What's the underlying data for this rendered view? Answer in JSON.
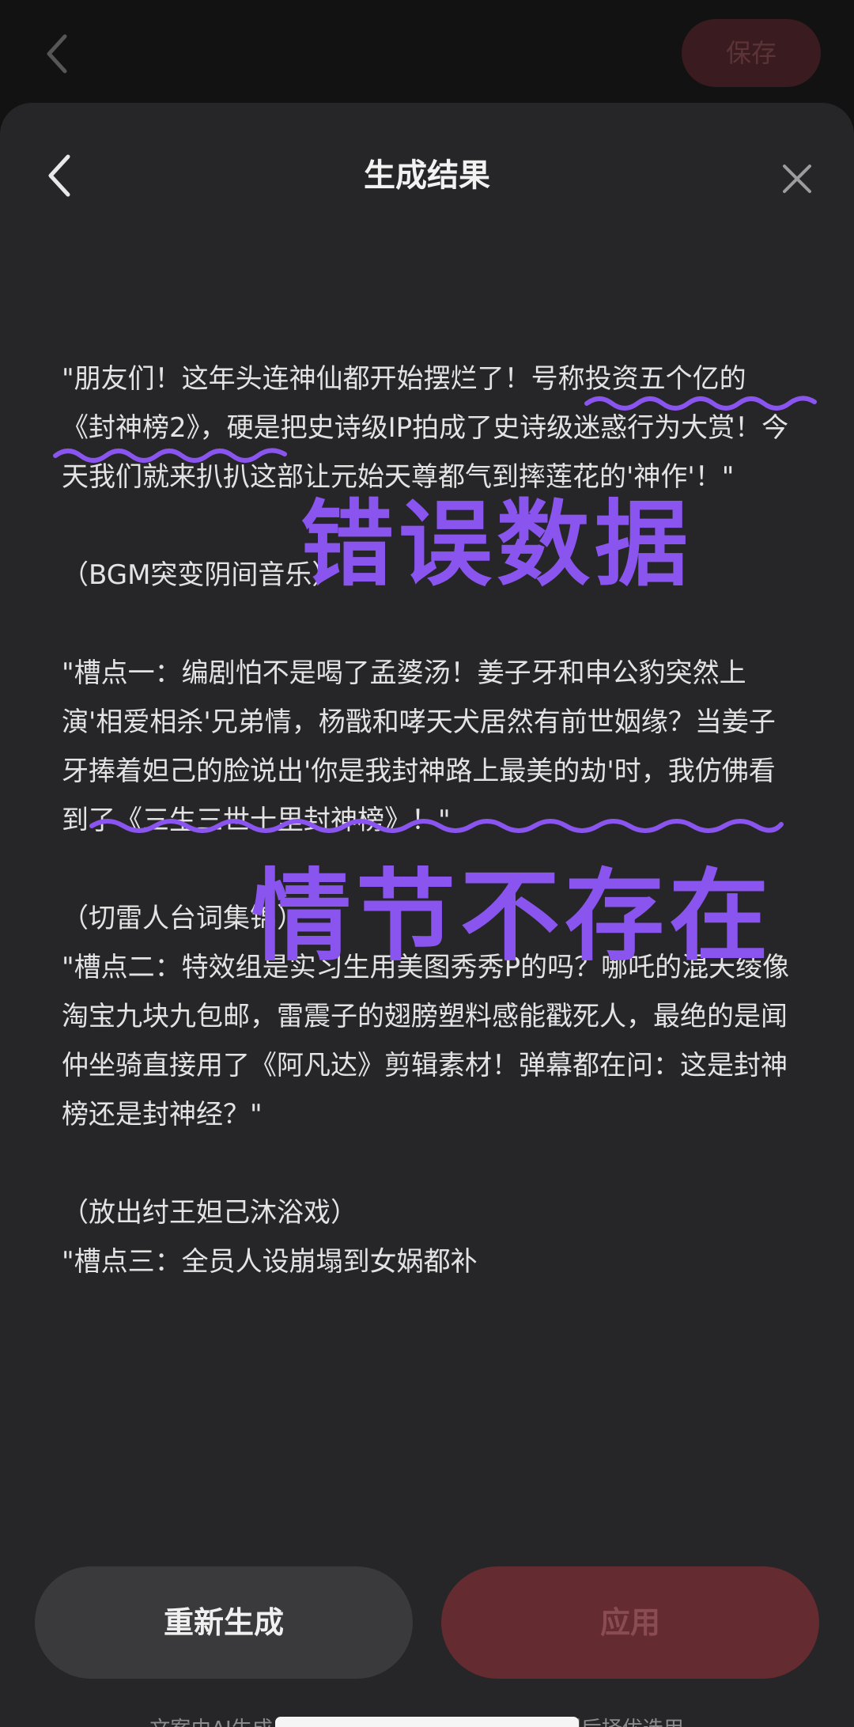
{
  "background_page": {
    "save_label": "保存"
  },
  "sheet": {
    "title": "生成结果",
    "paragraphs": [
      "\"朋友们！这年头连神仙都开始摆烂了！号称投资五个亿的《封神榜2》，硬是把史诗级IP拍成了史诗级迷惑行为大赏！今天我们就来扒扒这部让元始天尊都气到摔莲花的'神作'！\"",
      "（BGM突变阴间音乐）",
      "\"槽点一：编剧怕不是喝了孟婆汤！姜子牙和申公豹突然上演'相爱相杀'兄弟情，杨戬和哮天犬居然有前世姻缘？当姜子牙捧着妲己的脸说出'你是我封神路上最美的劫'时，我仿佛看到了《三生三世十里封神榜》！\"",
      "（切雷人台词集锦）",
      "\"槽点二：特效组是实习生用美图秀秀P的吗？哪吒的混天绫像淘宝九块九包邮，雷震子的翅膀塑料感能戳死人，最绝的是闻仲坐骑直接用了《阿凡达》剪辑素材！弹幕都在问：这是封神榜还是封神经？\"",
      "（放出纣王妲己沐浴戏）",
      "\"槽点三：全员人设崩塌到女娲都补"
    ],
    "regenerate_label": "重新生成",
    "apply_label": "应用",
    "disclaimer": "文案由AI生成，不代表平台观点，请您有效甄别后择优选用。"
  },
  "annotations": {
    "label_1": "错误数据",
    "label_2": "情节不存在",
    "color": "#8a55ee"
  },
  "colors": {
    "sheet_bg": "#262527",
    "apply_bg": "#642b30",
    "regenerate_bg": "#3a393b"
  }
}
